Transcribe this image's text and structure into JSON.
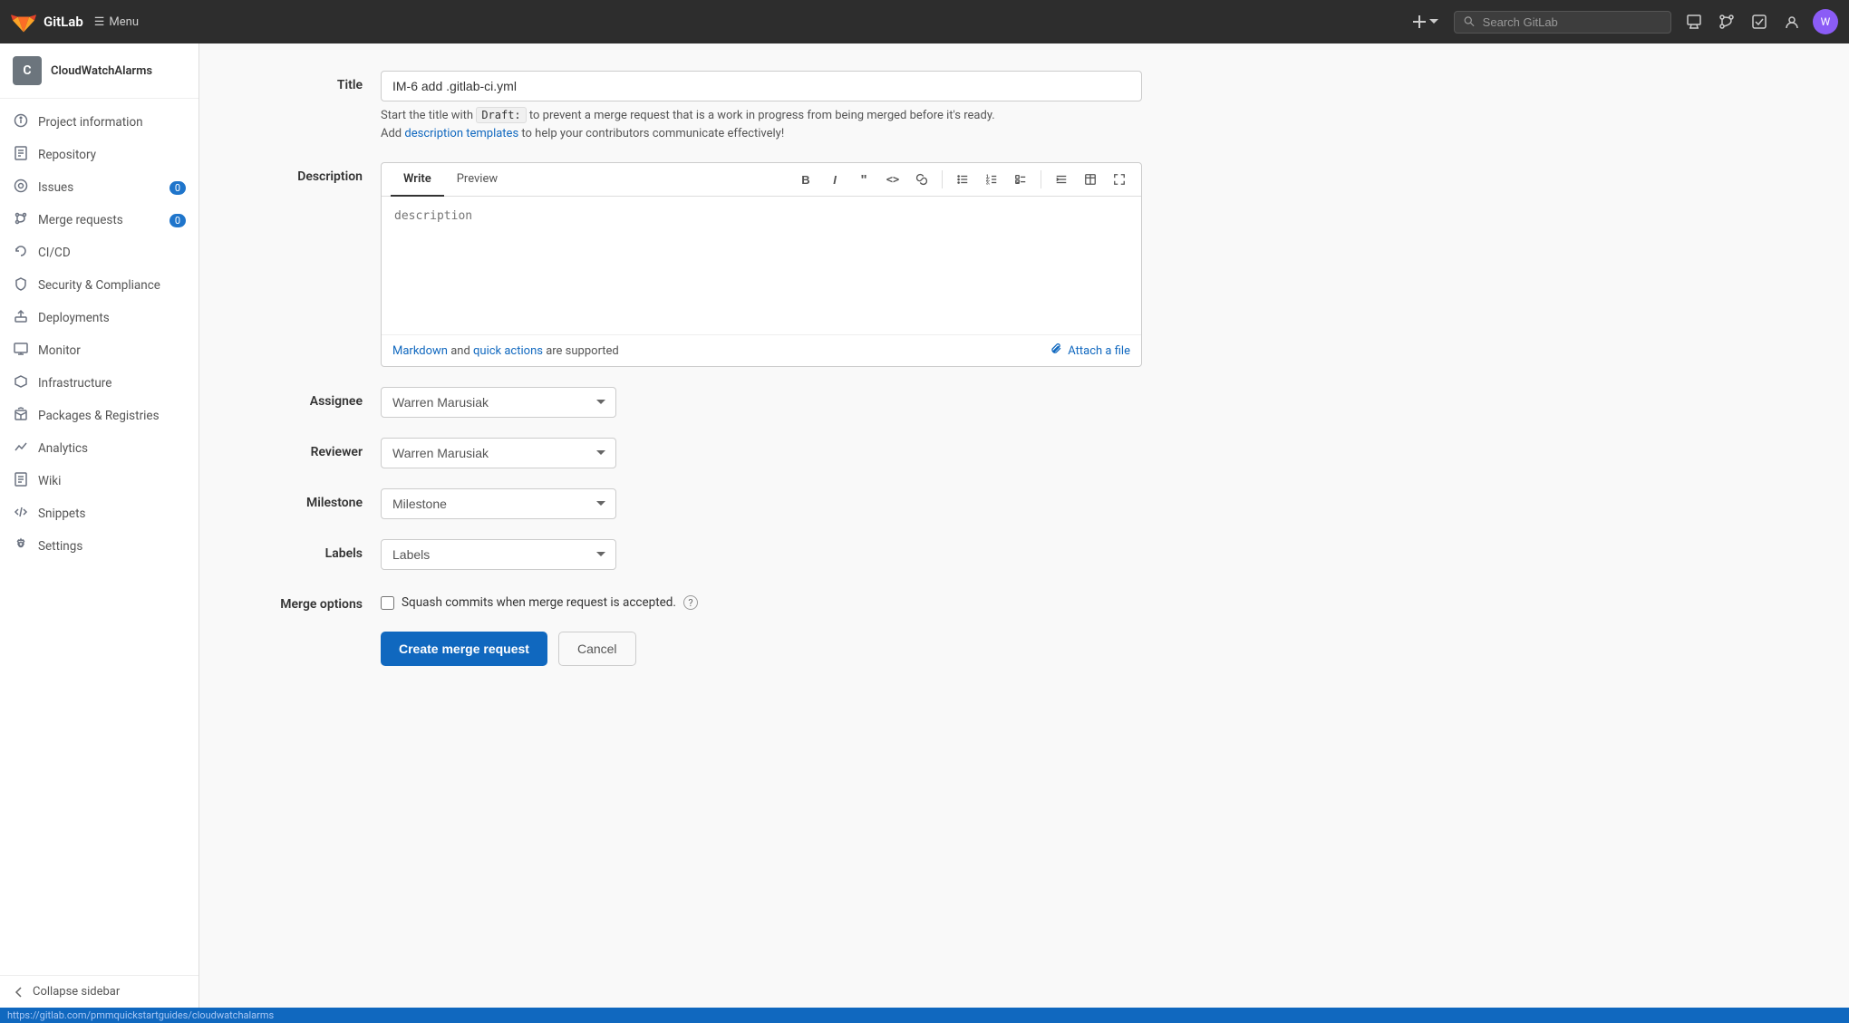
{
  "app": {
    "name": "GitLab",
    "logo_text": "🦊"
  },
  "navbar": {
    "menu_label": "Menu",
    "search_placeholder": "Search GitLab",
    "plus_icon": "+",
    "merge_icon": "⇄",
    "check_icon": "✓",
    "user_initial": "W"
  },
  "sidebar": {
    "project_initial": "C",
    "project_name": "CloudWatchAlarms",
    "items": [
      {
        "id": "project-information",
        "label": "Project information",
        "icon": "📋",
        "badge": null
      },
      {
        "id": "repository",
        "label": "Repository",
        "icon": "📁",
        "badge": null
      },
      {
        "id": "issues",
        "label": "Issues",
        "icon": "⊙",
        "badge": "0"
      },
      {
        "id": "merge-requests",
        "label": "Merge requests",
        "icon": "⇄",
        "badge": "0"
      },
      {
        "id": "cicd",
        "label": "CI/CD",
        "icon": "🚀",
        "badge": null
      },
      {
        "id": "security-compliance",
        "label": "Security & Compliance",
        "icon": "🛡",
        "badge": null
      },
      {
        "id": "deployments",
        "label": "Deployments",
        "icon": "📦",
        "badge": null
      },
      {
        "id": "monitor",
        "label": "Monitor",
        "icon": "📊",
        "badge": null
      },
      {
        "id": "infrastructure",
        "label": "Infrastructure",
        "icon": "🔧",
        "badge": null
      },
      {
        "id": "packages-registries",
        "label": "Packages & Registries",
        "icon": "📦",
        "badge": null
      },
      {
        "id": "analytics",
        "label": "Analytics",
        "icon": "📈",
        "badge": null
      },
      {
        "id": "wiki",
        "label": "Wiki",
        "icon": "📝",
        "badge": null
      },
      {
        "id": "snippets",
        "label": "Snippets",
        "icon": "✂",
        "badge": null
      },
      {
        "id": "settings",
        "label": "Settings",
        "icon": "⚙",
        "badge": null
      }
    ],
    "collapse_label": "Collapse sidebar"
  },
  "form": {
    "title_label": "Title",
    "title_value": "IM-6 add .gitlab-ci.yml",
    "hint_start": "Start the title with",
    "hint_code": "Draft:",
    "hint_end": "to prevent a merge request that is a work in progress from being merged before it's ready.",
    "hint_add": "Add",
    "hint_link": "description templates",
    "hint_link_end": "to help your contributors communicate effectively!",
    "description_label": "Description",
    "write_tab": "Write",
    "preview_tab": "Preview",
    "toolbar_buttons": [
      "B",
      "I",
      "\"",
      "<>",
      "🔗",
      "≡",
      "⋮",
      "☰",
      "«»",
      "⊞",
      "⛶"
    ],
    "desc_placeholder": "description",
    "markdown_text": "Markdown",
    "quick_actions_text": "quick actions",
    "supported_text": "are supported",
    "attach_label": "Attach a file",
    "assignee_label": "Assignee",
    "assignee_value": "Warren Marusiak",
    "reviewer_label": "Reviewer",
    "reviewer_value": "Warren Marusiak",
    "milestone_label": "Milestone",
    "milestone_placeholder": "Milestone",
    "labels_label": "Labels",
    "labels_placeholder": "Labels",
    "merge_options_label": "Merge options",
    "squash_label": "Squash commits when merge request is accepted.",
    "create_btn": "Create merge request",
    "cancel_btn": "Cancel"
  },
  "status_bar": {
    "url": "https://gitlab.com/pmmquickstartguides/cloudwatchalarms"
  }
}
